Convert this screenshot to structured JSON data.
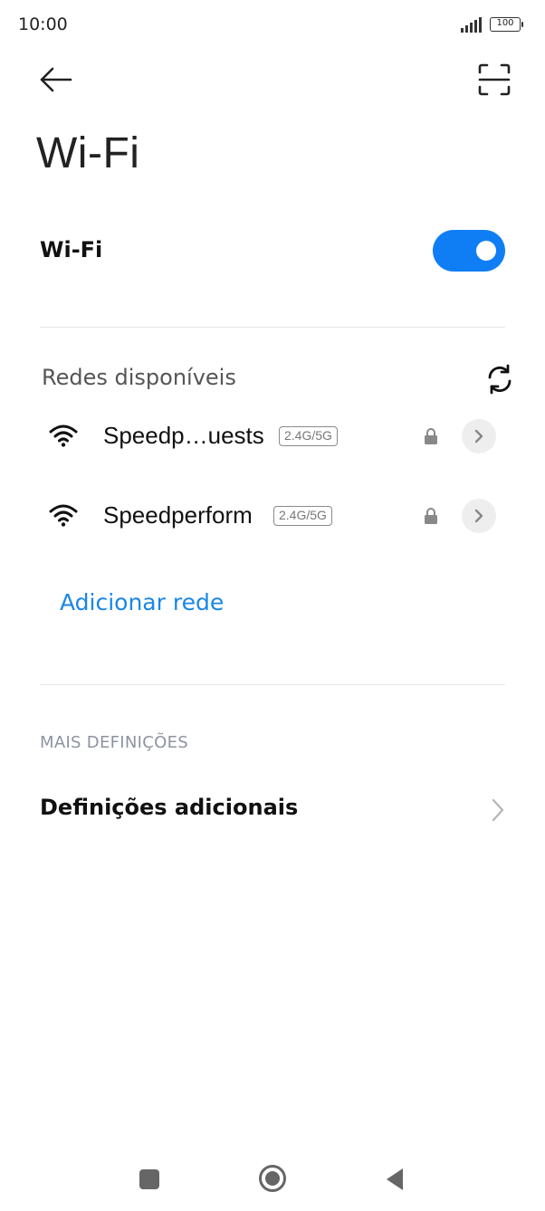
{
  "status_bar": {
    "time": "10:00",
    "battery": "100",
    "icons": [
      "signal-icon",
      "battery-icon"
    ]
  },
  "header": {
    "back_icon": "arrow-left-icon",
    "scan_icon": "scan-qr-icon",
    "title": "Wi-Fi"
  },
  "wifi_toggle": {
    "label": "Wi-Fi",
    "enabled": true,
    "accent_color": "#0f7ef4"
  },
  "available_networks": {
    "title": "Redes disponíveis",
    "refresh_icon": "refresh-icon",
    "items": [
      {
        "name": "Speedp…uests",
        "band": "2.4G/5G",
        "secured": true,
        "icon": "wifi-full-icon"
      },
      {
        "name": "Speedperform",
        "band": "2.4G/5G",
        "secured": true,
        "icon": "wifi-full-icon"
      }
    ],
    "add_network": "Adicionar rede",
    "link_color": "#1a86e8"
  },
  "more_settings": {
    "header": "MAIS DEFINIÇÕES",
    "additional": "Definições adicionais"
  },
  "navbar": {
    "icons": [
      "recents-square-icon",
      "home-circle-icon",
      "back-triangle-icon"
    ]
  }
}
